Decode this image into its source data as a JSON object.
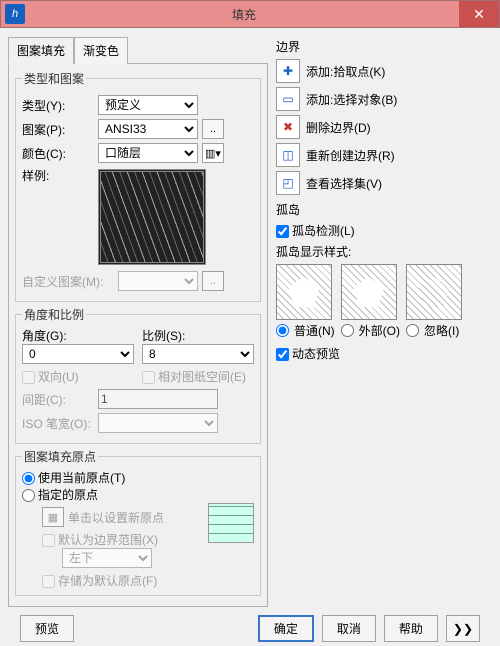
{
  "window": {
    "title": "填充"
  },
  "tabs": {
    "hatch": "图案填充",
    "gradient": "渐变色"
  },
  "typeGroup": {
    "legend": "类型和图案",
    "typeLabel": "类型(Y):",
    "typeValue": "预定义",
    "patternLabel": "图案(P):",
    "patternValue": "ANSI33",
    "colorLabel": "颜色(C):",
    "colorValue": "口随层",
    "sampleLabel": "样例:",
    "customLabel": "自定义图案(M):"
  },
  "scaleGroup": {
    "legend": "角度和比例",
    "angleLabel": "角度(G):",
    "angleValue": "0",
    "scaleLabel": "比例(S):",
    "scaleValue": "8",
    "bidir": "双向(U)",
    "relPaper": "相对图纸空间(E)",
    "spacingLabel": "间距(C):",
    "spacingValue": "1",
    "isoPenLabel": "ISO 笔宽(O):"
  },
  "originGroup": {
    "legend": "图案填充原点",
    "useCurrent": "使用当前原点(T)",
    "specify": "指定的原点",
    "clickNew": "单击以设置新原点",
    "defaultExtent": "默认为边界范围(X)",
    "position": "左下",
    "store": "存储为默认原点(F)"
  },
  "boundary": {
    "legend": "边界",
    "addPick": "添加:拾取点(K)",
    "addSelect": "添加:选择对象(B)",
    "remove": "删除边界(D)",
    "recreate": "重新创建边界(R)",
    "viewSel": "查看选择集(V)"
  },
  "island": {
    "legend": "孤岛",
    "detect": "孤岛检测(L)",
    "styleLabel": "孤岛显示样式:",
    "normal": "普通(N)",
    "outer": "外部(O)",
    "ignore": "忽略(I)"
  },
  "preview": {
    "dynamic": "动态预览"
  },
  "footer": {
    "preview": "预览",
    "ok": "确定",
    "cancel": "取消",
    "help": "帮助",
    "more": "❯❯"
  }
}
